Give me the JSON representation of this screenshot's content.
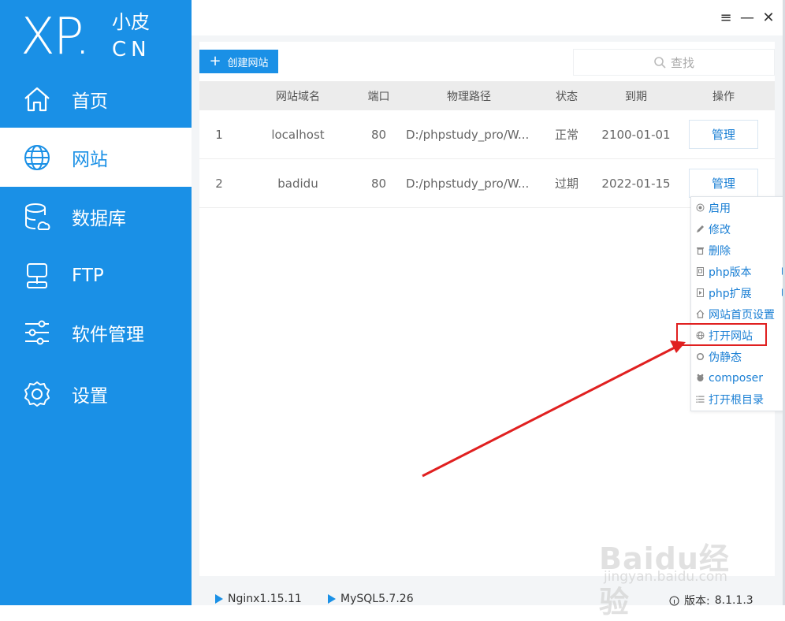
{
  "sidebar": {
    "logo": {
      "big": "XP.",
      "small_top": "小皮",
      "small_bottom": "CN"
    },
    "items": [
      {
        "label": "首页",
        "icon": "home-icon",
        "active": false
      },
      {
        "label": "网站",
        "icon": "globe-icon",
        "active": true
      },
      {
        "label": "数据库",
        "icon": "database-icon",
        "active": false
      },
      {
        "label": "FTP",
        "icon": "ftp-icon",
        "active": false
      },
      {
        "label": "软件管理",
        "icon": "sliders-icon",
        "active": false
      },
      {
        "label": "设置",
        "icon": "gear-icon",
        "active": false
      }
    ]
  },
  "window": {
    "menu": "≡",
    "minimize": "—",
    "close": "✕"
  },
  "toolbar": {
    "create_plus": "+",
    "create_label": "创建网站",
    "search_placeholder": "查找"
  },
  "table": {
    "headers": [
      "网站域名",
      "端口",
      "物理路径",
      "状态",
      "到期",
      "操作"
    ],
    "rows": [
      {
        "idx": "1",
        "domain": "localhost",
        "port": "80",
        "path": "D:/phpstudy_pro/W...",
        "status": "正常",
        "expire": "2100-01-01",
        "action": "管理"
      },
      {
        "idx": "2",
        "domain": "badidu",
        "port": "80",
        "path": "D:/phpstudy_pro/W...",
        "status": "过期",
        "expire": "2022-01-15",
        "action": "管理"
      }
    ]
  },
  "context_menu": {
    "items": [
      {
        "label": "启用",
        "icon": "radio-icon",
        "submenu": false
      },
      {
        "label": "修改",
        "icon": "pencil-icon",
        "submenu": false
      },
      {
        "label": "删除",
        "icon": "trash-icon",
        "submenu": false
      },
      {
        "label": "php版本",
        "icon": "php-file-icon",
        "submenu": true
      },
      {
        "label": "php扩展",
        "icon": "php-ext-icon",
        "submenu": true
      },
      {
        "label": "网站首页设置",
        "icon": "house-icon",
        "submenu": false
      },
      {
        "label": "打开网站",
        "icon": "globe-small-icon",
        "submenu": false
      },
      {
        "label": "伪静态",
        "icon": "refresh-icon",
        "submenu": false
      },
      {
        "label": "composer",
        "icon": "composer-icon",
        "submenu": false
      },
      {
        "label": "打开根目录",
        "icon": "list-icon",
        "submenu": false
      }
    ],
    "highlighted": "打开网站"
  },
  "footer": {
    "nginx": "Nginx1.15.11",
    "mysql": "MySQL5.7.26",
    "version_label": "版本:",
    "version": "8.1.1.3"
  },
  "watermark": {
    "logo": "Baidu经验",
    "url": "jingyan.baidu.com"
  },
  "colors": {
    "brand": "#1a90e6",
    "annotation": "#e02020"
  }
}
